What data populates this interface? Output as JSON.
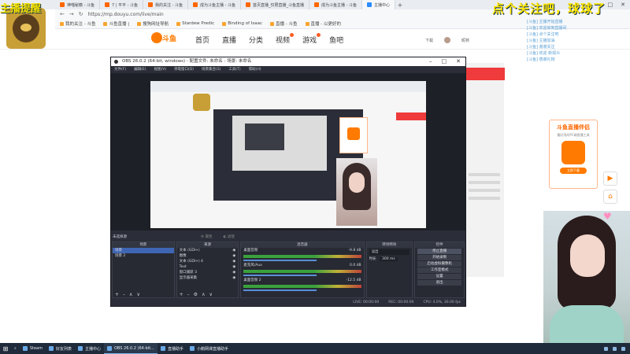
{
  "browser": {
    "tabs": [
      {
        "label": "神喵秘籍 - 斗鱼",
        "active": false
      },
      {
        "label": "7 | 平平 - 斗鱼",
        "active": false
      },
      {
        "label": "我的关注 - 斗鱼",
        "active": false
      },
      {
        "label": "成为斗鱼主播 - 斗鱼",
        "active": false
      },
      {
        "label": "首页直播_仅限直播_斗鱼直播",
        "active": false
      },
      {
        "label": "成为斗鱼主播 - 斗鱼",
        "active": false
      },
      {
        "label": "主播中心",
        "active": true
      }
    ],
    "url": "https://mp.douyu.com/live/main",
    "bookmarks": [
      "我的关注 - 斗鱼",
      "斗鱼直播 |",
      "搜狗网址导航",
      "Stardew Predic",
      "Binding of Isaac",
      "直播 - 斗鱼",
      "直播 - 以更好的"
    ]
  },
  "overlay": {
    "top_left": "主播提醒",
    "top_right": "点个关注吧，球球了"
  },
  "douyu_header": {
    "logo_text": "斗鱼",
    "nav": [
      "首页",
      "直播",
      "分类",
      "视频",
      "游戏",
      "鱼吧"
    ],
    "right_items": [
      "下载",
      "昵称"
    ]
  },
  "chat": {
    "lines": [
      "[斗鱼] 主播开始直播",
      "[斗鱼] 欢迎来到直播间",
      "[斗鱼] 点个关注吧",
      "[斗鱼] 主播加油",
      "[斗鱼] 谢谢关注",
      "[斗鱼] 欢迎 新观众",
      "[斗鱼] 感谢礼物"
    ]
  },
  "promo": {
    "title": "斗鱼直播伴侣",
    "subtitle": "最好用的PC端直播工具",
    "button": "立即下载"
  },
  "obs": {
    "title": "OBS 26.0.2 (64-bit, windows) - 配置文件: 未命名 - 场景: 未命名",
    "menu": [
      "文件(F)",
      "编辑(E)",
      "视图(V)",
      "停靠窗口(D)",
      "场景集合(S)",
      "工具(T)",
      "帮助(H)"
    ],
    "no_source_selected": "未选择源",
    "properties_label": "属性",
    "filters_label": "滤镜",
    "docks": {
      "scenes": {
        "header": "场景",
        "items": [
          "场景",
          "场景 2"
        ]
      },
      "sources": {
        "header": "来源",
        "items": [
          "文本 (GDI+)",
          "图像",
          "文本 (GDI+) 4",
          "Text",
          "窗口捕获 3",
          "显示器采集"
        ]
      },
      "mixer": {
        "header": "混音器",
        "items": [
          "桌面音频",
          "麦克风/Aux",
          "桌面音频 2"
        ],
        "levels": [
          "-9.8 dB",
          "0.0 dB",
          "-12.5 dB"
        ]
      },
      "transitions": {
        "header": "转场特效",
        "fade": "淡出",
        "duration_label": "时长",
        "duration_value": "300 ms"
      },
      "controls": {
        "header": "控件",
        "buttons": [
          "停止直播",
          "开始录制",
          "启动虚拟摄像机",
          "工作室模式",
          "设置",
          "退出"
        ]
      }
    },
    "status": {
      "live": "LIVE: 00:00:00",
      "rec": "REC: 00:00:00",
      "cpu": "CPU: 4.0%, 30.00 fps"
    }
  },
  "taskbar": {
    "items": [
      "Steam",
      "好友列表",
      "主播中心",
      "OBS 26.0.2 (64-bit...",
      "直播助手",
      "小鹅网课直播助手"
    ],
    "open_index": 3
  },
  "colors": {
    "douyu_orange": "#ff7a00",
    "obs_bg": "#2b2e38",
    "overlay_yellow": "#f6e300",
    "taskbar": "#1f2a3a"
  }
}
